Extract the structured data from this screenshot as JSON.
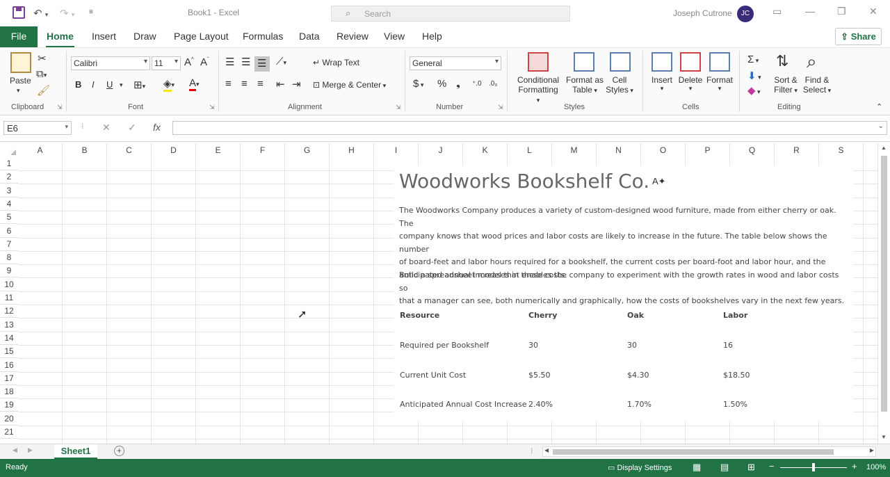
{
  "titlebar": {
    "doc_title": "Book1  -  Excel",
    "search_placeholder": "Search",
    "user_name": "Joseph Cutrone",
    "user_initials": "JC"
  },
  "tabs": {
    "file": "File",
    "items": [
      "Home",
      "Insert",
      "Draw",
      "Page Layout",
      "Formulas",
      "Data",
      "Review",
      "View",
      "Help"
    ],
    "active": "Home",
    "share": "Share"
  },
  "ribbon": {
    "clipboard": {
      "label": "Clipboard",
      "paste": "Paste"
    },
    "font": {
      "label": "Font",
      "name": "Calibri",
      "size": "11",
      "bold": "B",
      "italic": "I",
      "underline": "U"
    },
    "alignment": {
      "label": "Alignment",
      "wrap_text": "Wrap Text",
      "merge_center": "Merge & Center"
    },
    "number": {
      "label": "Number",
      "format": "General"
    },
    "styles": {
      "label": "Styles",
      "conditional_1": "Conditional",
      "conditional_2": "Formatting",
      "format_table_1": "Format as",
      "format_table_2": "Table",
      "cell_styles_1": "Cell",
      "cell_styles_2": "Styles"
    },
    "cells": {
      "label": "Cells",
      "insert": "Insert",
      "delete": "Delete",
      "format": "Format"
    },
    "editing": {
      "label": "Editing",
      "sort_1": "Sort &",
      "sort_2": "Filter",
      "find_1": "Find &",
      "find_2": "Select"
    }
  },
  "formula_bar": {
    "name_box": "E6",
    "formula": ""
  },
  "columns": [
    "A",
    "B",
    "C",
    "D",
    "E",
    "F",
    "G",
    "H",
    "I",
    "J",
    "K",
    "L",
    "M",
    "N",
    "O",
    "P",
    "Q",
    "R",
    "S"
  ],
  "rows": [
    "1",
    "2",
    "3",
    "4",
    "5",
    "6",
    "7",
    "8",
    "9",
    "10",
    "11",
    "12",
    "13",
    "14",
    "15",
    "16",
    "17",
    "18",
    "19",
    "20",
    "21"
  ],
  "card": {
    "title": "Woodworks Bookshelf Co.",
    "para1": [
      "The Woodworks Company produces a variety of custom-designed wood furniture, made from either cherry or oak.  The",
      "company knows that wood prices and labor costs are likely to increase in the future.  The table below shows the number",
      "of board-feet and labor hours required for a bookshelf, the current costs per board-foot and labor hour, and the",
      "anticipated annual increases in these costs."
    ],
    "para2": [
      "Build a spreadsheet model that enables the company to experiment with the growth rates in wood and labor costs so",
      "that a manager can see, both numerically and graphically, how the costs of bookshelves vary in the next few years."
    ],
    "table": {
      "headers": [
        "Resource",
        "Cherry",
        "Oak",
        "Labor"
      ],
      "rows": [
        [
          "Required per Bookshelf",
          "30",
          "30",
          "16"
        ],
        [
          "Current Unit Cost",
          "$5.50",
          "$4.30",
          "$18.50"
        ],
        [
          "Anticipated Annual Cost Increase",
          "2.40%",
          "1.70%",
          "1.50%"
        ]
      ]
    }
  },
  "sheets": [
    "Sheet1"
  ],
  "status": {
    "ready": "Ready",
    "display_settings": "Display Settings",
    "zoom": "100%"
  }
}
